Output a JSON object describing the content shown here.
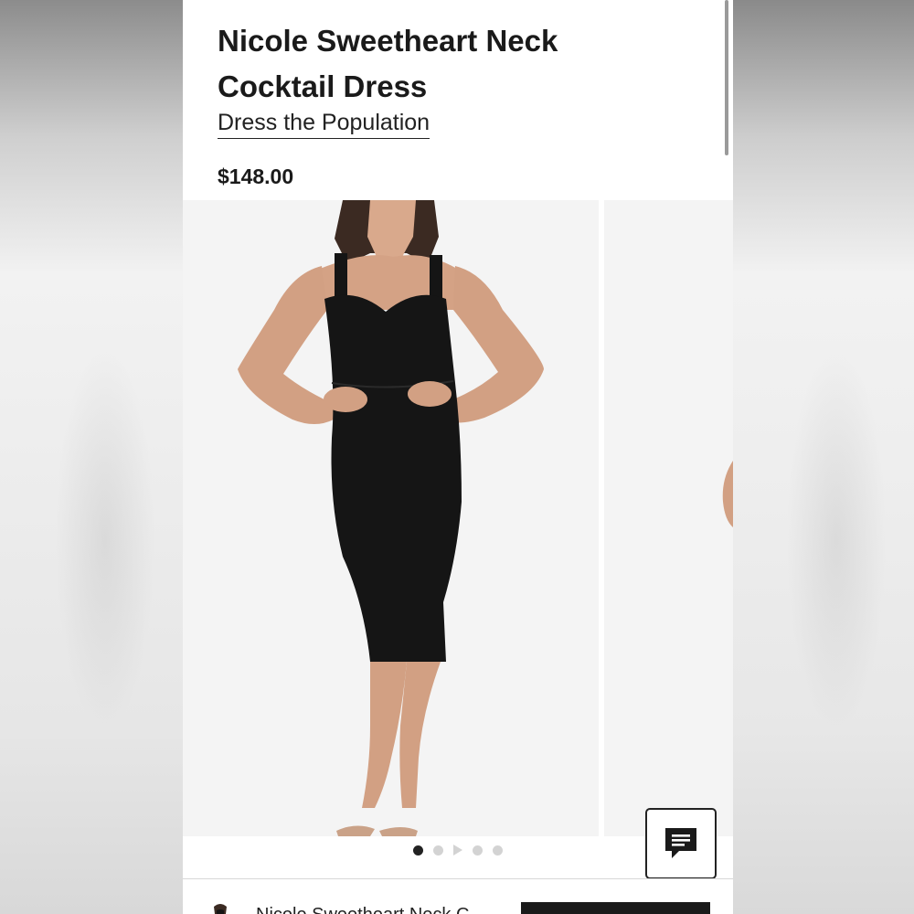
{
  "product": {
    "title_line1": "Nicole Sweetheart Neck",
    "title_line2": "Cocktail Dress",
    "brand": "Dress the Population",
    "price": "$148.00"
  },
  "gallery": {
    "image_count": 5,
    "current_index": 1,
    "icons": [
      "dot",
      "dot",
      "play-icon",
      "dot",
      "dot"
    ]
  },
  "chat": {
    "icon": "chat-icon"
  },
  "bottom_bar": {
    "name": "Nicole Sweetheart Neck C"
  },
  "colors": {
    "text": "#1a1a1a",
    "photo_bg": "#f4f4f4",
    "dress": "#151515",
    "dot_active": "#222222",
    "dot_inactive": "#d3d3d3"
  }
}
